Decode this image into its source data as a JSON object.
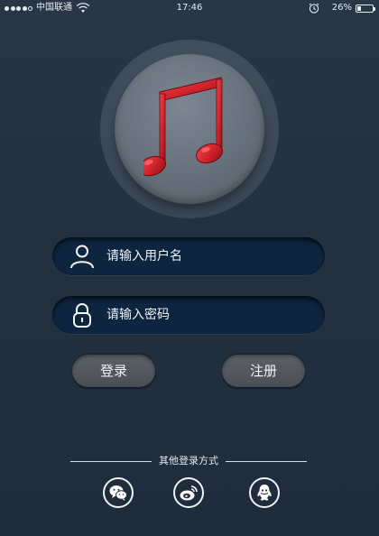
{
  "status_bar": {
    "carrier": "中国联通",
    "time": "17:46",
    "battery": "26%",
    "battery_level": 0.26,
    "signal_dots_filled": 4,
    "signal_dots_total": 5,
    "icons": [
      "signal-dots-icon",
      "wifi-icon",
      "alarm-icon",
      "battery-icon"
    ]
  },
  "logo": {
    "icon": "music-note-icon",
    "colors": {
      "note": "#d3242c",
      "disc": "#6b7580"
    }
  },
  "form": {
    "username": {
      "placeholder": "请输入用户名",
      "value": "",
      "icon": "user-icon"
    },
    "password": {
      "placeholder": "请输入密码",
      "value": "",
      "icon": "lock-icon"
    }
  },
  "buttons": {
    "login": "登录",
    "register": "注册"
  },
  "other_login": {
    "label": "其他登录方式",
    "providers": [
      {
        "name": "wechat",
        "icon": "wechat-icon"
      },
      {
        "name": "weibo",
        "icon": "weibo-icon"
      },
      {
        "name": "qq",
        "icon": "qq-icon"
      }
    ]
  },
  "colors": {
    "background": "#243140",
    "field": "#0e2540",
    "button": "#52575d",
    "text": "#eef2f6"
  }
}
